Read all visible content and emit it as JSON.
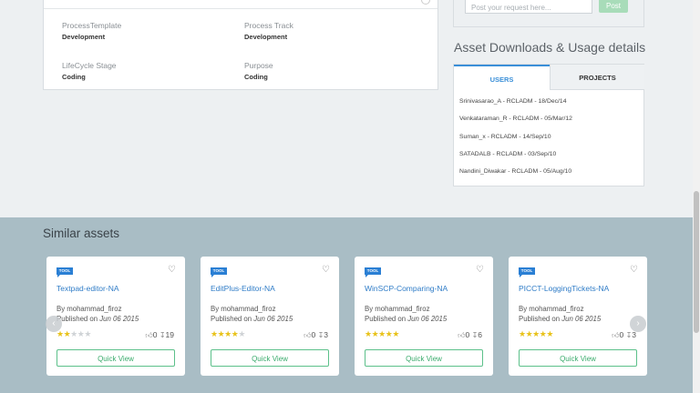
{
  "info": {
    "fields": [
      {
        "label": "ProcessTemplate",
        "value": "Development"
      },
      {
        "label": "Process Track",
        "value": "Development"
      },
      {
        "label": "LifeCycle Stage",
        "value": "Coding"
      },
      {
        "label": "Purpose",
        "value": "Coding"
      }
    ]
  },
  "request": {
    "placeholder": "Post your request here...",
    "post_label": "Post"
  },
  "downloads": {
    "heading": "Asset Downloads & Usage details",
    "tabs": {
      "users": "USERS",
      "projects": "PROJECTS"
    },
    "items": [
      "Srinivasarao_A - RCLADM - 18/Dec/14",
      "Venkataraman_R - RCLADM - 05/Mar/12",
      "Suman_x - RCLADM - 14/Sep/10",
      "SATADALB - RCLADM - 03/Sep/10",
      "Nandini_Diwakar - RCLADM - 05/Aug/10"
    ]
  },
  "similar": {
    "heading": "Similar assets",
    "cards": [
      {
        "badge": "TOOL",
        "title": "Textpad-editor-NA",
        "by": "By mohammad_firoz",
        "published_prefix": "Published on ",
        "date": "Jun 06 2015",
        "rating": 2,
        "likes": "0",
        "downloads": "19",
        "button": "Quick View"
      },
      {
        "badge": "TOOL",
        "title": "EditPlus-Editor-NA",
        "by": "By mohammad_firoz",
        "published_prefix": "Published on ",
        "date": "Jun 06 2015",
        "rating": 4,
        "likes": "0",
        "downloads": "3",
        "button": "Quick View"
      },
      {
        "badge": "TOOL",
        "title": "WinSCP-Comparing-NA",
        "by": "By mohammad_firoz",
        "published_prefix": "Published on ",
        "date": "Jun 06 2015",
        "rating": 5,
        "likes": "0",
        "downloads": "6",
        "button": "Quick View"
      },
      {
        "badge": "TOOL",
        "title": "PICCT-LoggingTickets-NA",
        "by": "By mohammad_firoz",
        "published_prefix": "Published on ",
        "date": "Jun 06 2015",
        "rating": 5,
        "likes": "0",
        "downloads": "3",
        "button": "Quick View"
      }
    ]
  },
  "colors": {
    "accent": "#3a8fd8",
    "star": "#e8c21a",
    "quick_view": "#3aab6c",
    "similar_bg": "#a9bdc5"
  },
  "icons": {
    "heart": "heart-icon",
    "like": "thumbs-up-icon",
    "download": "download-icon",
    "prev": "chevron-left-icon",
    "next": "chevron-right-icon"
  }
}
